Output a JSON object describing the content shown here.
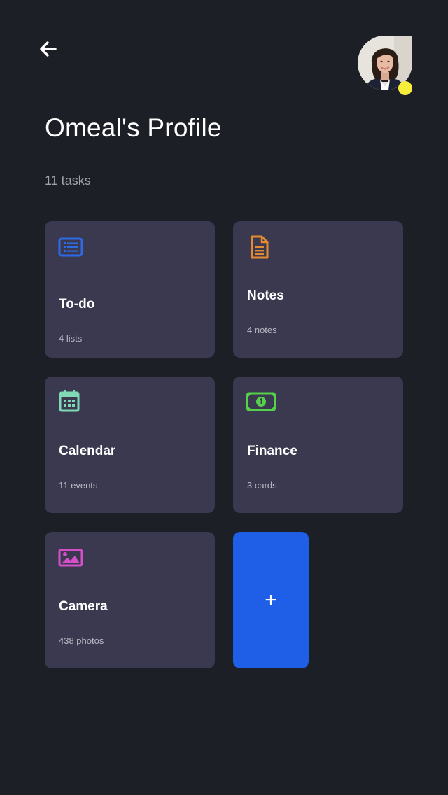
{
  "header": {
    "back_icon": "arrow-left-icon",
    "avatar_description": "user-profile-photo",
    "status_color": "#f6ee3a"
  },
  "profile": {
    "title": "Omeal's Profile",
    "task_count": "11 tasks"
  },
  "cards": [
    {
      "title": "To-do",
      "subtitle": "4 lists",
      "icon": "list-icon",
      "icon_color": "#2d6be6"
    },
    {
      "title": "Notes",
      "subtitle": "4 notes",
      "icon": "document-icon",
      "icon_color": "#e58a2e"
    },
    {
      "title": "Calendar",
      "subtitle": "11 events",
      "icon": "calendar-icon",
      "icon_color": "#7fd9b5"
    },
    {
      "title": "Finance",
      "subtitle": "3 cards",
      "icon": "money-icon",
      "icon_color": "#55d14a"
    },
    {
      "title": "Camera",
      "subtitle": "438 photos",
      "icon": "image-icon",
      "icon_color": "#d64fc9"
    }
  ],
  "add_button": {
    "label": "+",
    "color": "#1f5fe8"
  }
}
